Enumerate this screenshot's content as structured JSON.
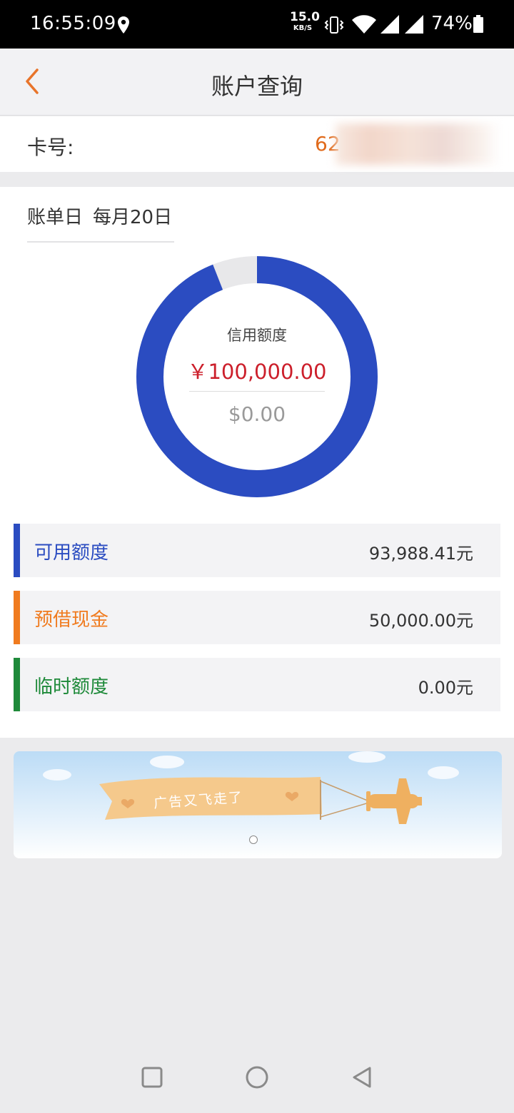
{
  "status_bar": {
    "time": "16:55:09",
    "net_speed_value": "15.0",
    "net_speed_unit": "KB/S",
    "battery_percent": "74%"
  },
  "header": {
    "title": "账户查询"
  },
  "card": {
    "label": "卡号:",
    "number_visible": "62"
  },
  "bill": {
    "label": "账单日",
    "value": "每月20日"
  },
  "donut": {
    "label": "信用额度",
    "cny_amount": "￥100,000.00",
    "usd_amount": "$0.00",
    "used_fraction": 0.94,
    "colors": {
      "available": "#2b4cc1",
      "remainder": "#e8e8ea"
    }
  },
  "limits": [
    {
      "label": "可用额度",
      "value": "93,988.41元",
      "color": "#2b4cc1"
    },
    {
      "label": "预借现金",
      "value": "50,000.00元",
      "color": "#f07b1f"
    },
    {
      "label": "临时额度",
      "value": "0.00元",
      "color": "#1f8a3a"
    }
  ],
  "banner": {
    "text": "广告又飞走了",
    "icon": "airplane-icon"
  },
  "nav": {
    "recents_icon": "square-icon",
    "home_icon": "circle-icon",
    "back_icon": "triangle-back-icon"
  }
}
